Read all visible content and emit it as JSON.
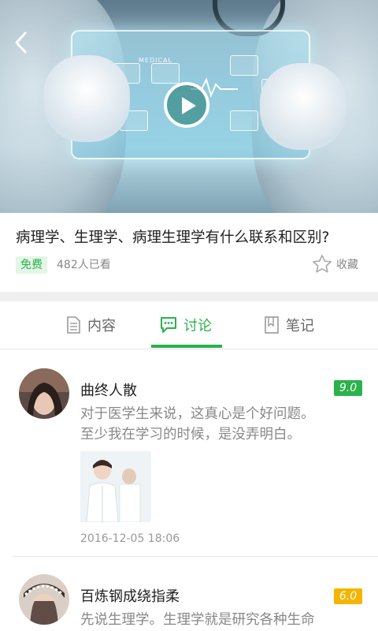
{
  "video": {
    "screen_label": "MEDICAL"
  },
  "course": {
    "title": "病理学、生理学、病理生理学有什么联系和区别?",
    "price_badge": "免费",
    "views": "482人已看",
    "favorite_label": "收藏"
  },
  "tabs": [
    {
      "label": "内容",
      "icon": "document-icon",
      "active": false
    },
    {
      "label": "讨论",
      "icon": "chat-bubble-icon",
      "active": true
    },
    {
      "label": "笔记",
      "icon": "bookmark-icon",
      "active": false
    }
  ],
  "comments": [
    {
      "username": "曲终人散",
      "score": "9.0",
      "score_color": "#2bb24c",
      "lines": [
        "对于医学生来说，这真心是个好问题。",
        "至少我在学习的时候，是没弄明白。"
      ],
      "time": "2016-12-05 18:06",
      "has_image": true
    },
    {
      "username": "百炼钢成绕指柔",
      "score": "6.0",
      "score_color": "#f4b400",
      "lines": [
        "先说生理学。生理学就是研究各种生命"
      ],
      "has_image": false
    }
  ],
  "colors": {
    "accent": "#2bb24c",
    "score_high": "#2bb24c",
    "score_mid": "#f4b400",
    "muted_text": "#888888"
  }
}
